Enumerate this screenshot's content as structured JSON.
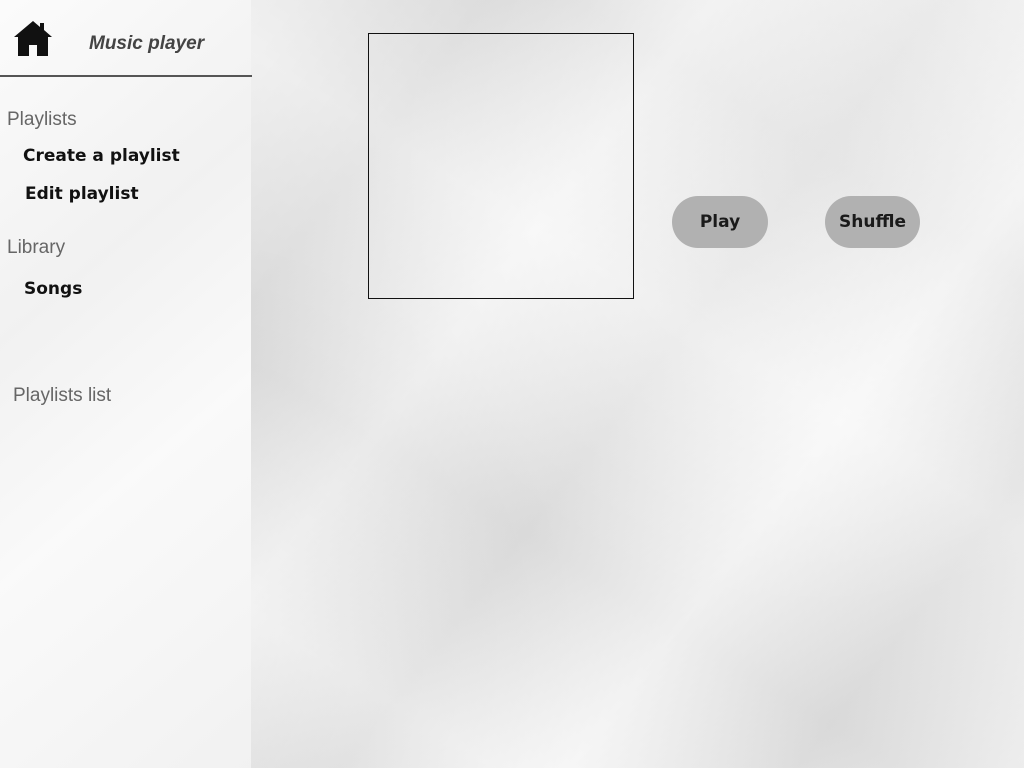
{
  "app": {
    "title": "Music player"
  },
  "sidebar": {
    "home_icon": "home-icon",
    "sections": {
      "playlists_label": "Playlists",
      "create_playlist": "Create a playlist",
      "edit_playlist": "Edit playlist",
      "library_label": "Library",
      "songs": "Songs",
      "playlists_list_label": "Playlists list"
    }
  },
  "main": {
    "artwork": "",
    "play_label": "Play",
    "shuffle_label": "Shuffle"
  },
  "colors": {
    "sidebar_bg": "#f6f6f6",
    "button_bg": "#b1b1b1",
    "text_dark": "#111111",
    "text_muted": "#666666"
  }
}
